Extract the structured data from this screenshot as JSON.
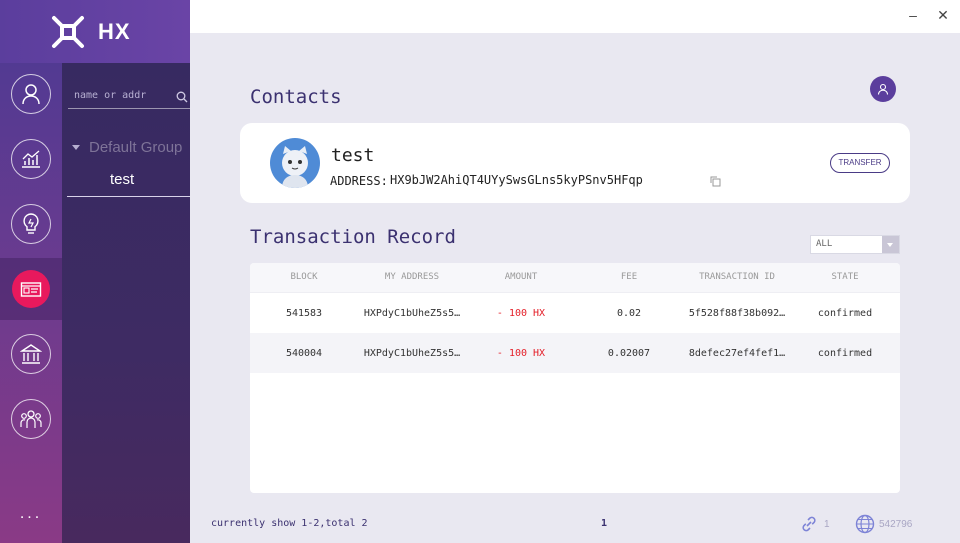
{
  "app": {
    "name": "HX"
  },
  "window": {
    "minimize": "–",
    "close": "✕"
  },
  "sidebar": {
    "items": [
      {
        "name": "account",
        "icon": "user-icon"
      },
      {
        "name": "market",
        "icon": "chart-icon"
      },
      {
        "name": "ideas",
        "icon": "bulb-icon"
      },
      {
        "name": "contacts",
        "icon": "contact-card-icon",
        "active": true
      },
      {
        "name": "bank",
        "icon": "bank-icon"
      },
      {
        "name": "community",
        "icon": "people-icon"
      }
    ],
    "more": "..."
  },
  "contacts_panel": {
    "search_placeholder": "name or addr",
    "group_label": "Default Group",
    "contacts": [
      "test"
    ]
  },
  "main": {
    "title": "Contacts",
    "contact": {
      "name": "test",
      "address_label": "ADDRESS:",
      "address": "HX9bJW2AhiQT4UYySwsGLns5kyPSnv5HFqp",
      "transfer_label": "TRANSFER"
    },
    "records_title": "Transaction Record",
    "filter_value": "ALL",
    "table": {
      "columns": [
        "BLOCK",
        "MY ADDRESS",
        "AMOUNT",
        "FEE",
        "TRANSACTION ID",
        "STATE"
      ],
      "rows": [
        {
          "block": "541583",
          "address": "HXPdyC1bUheZ5s5…",
          "amount": "- 100 HX",
          "fee": "0.02",
          "txid": "5f528f88f38b092…",
          "state": "confirmed"
        },
        {
          "block": "540004",
          "address": "HXPdyC1bUheZ5s5…",
          "amount": "- 100 HX",
          "fee": "0.02007",
          "txid": "8defec27ef4fef1…",
          "state": "confirmed"
        }
      ]
    },
    "footer": "currently show 1-2,total 2",
    "page": "1"
  },
  "statusbar": {
    "connections": "1",
    "block_height": "542796"
  },
  "colors": {
    "accent": "#5b3e9d",
    "active": "#e8195d",
    "negative": "#e4202a"
  }
}
